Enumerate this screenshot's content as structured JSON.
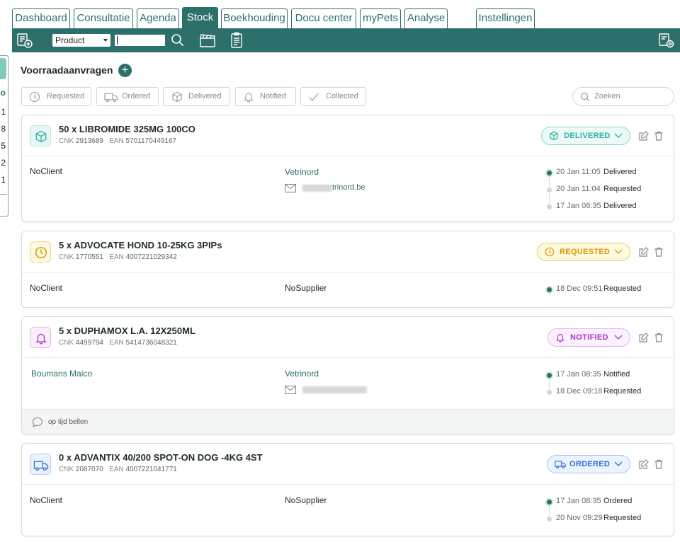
{
  "nav": {
    "tabs": [
      {
        "label": "Dashboard"
      },
      {
        "label": "Consultatie"
      },
      {
        "label": "Agenda"
      },
      {
        "label": "Stock",
        "active": true
      },
      {
        "label": "Boekhouding"
      },
      {
        "label": "Docu center"
      },
      {
        "label": "myPets"
      },
      {
        "label": "Analyse"
      },
      {
        "label": "Instellingen"
      }
    ]
  },
  "toolbar": {
    "search_type": "Product",
    "search_value": ""
  },
  "left_panel": {
    "items": [
      "o",
      "1",
      "8",
      "5",
      "2",
      "1"
    ]
  },
  "page": {
    "title": "Voorraadaanvragen"
  },
  "filters": [
    {
      "label": "Requested",
      "icon": "clock-icon"
    },
    {
      "label": "Ordered",
      "icon": "truck-icon"
    },
    {
      "label": "Delivered",
      "icon": "box-icon"
    },
    {
      "label": "Notified",
      "icon": "bell-icon"
    },
    {
      "label": "Collected",
      "icon": "check-icon"
    }
  ],
  "search": {
    "placeholder": "Zoeken"
  },
  "colors": {
    "brand": "#2d6f6b",
    "delivered": "#2bb5a0",
    "requested": "#d99a00",
    "notified": "#b035c9",
    "ordered": "#2a6fd6"
  },
  "requests": [
    {
      "product": "50 x LIBROMIDE 325MG 100CO",
      "cnk_label": "CNK",
      "cnk": "2913689",
      "ean_label": "EAN",
      "ean": "5701170449167",
      "status": "DELIVERED",
      "client": "NoClient",
      "supplier": "Vetrinord",
      "email_domain": "trinord.be",
      "timeline": [
        {
          "time": "20 Jan 11:05",
          "status": "Delivered"
        },
        {
          "time": "20 Jan 11:04",
          "status": "Requested"
        },
        {
          "time": "17 Jan 08:35",
          "status": "Delivered"
        }
      ]
    },
    {
      "product": "5 x ADVOCATE HOND 10-25KG 3PIPs",
      "cnk_label": "CNK",
      "cnk": "1770551",
      "ean_label": "EAN",
      "ean": "4007221029342",
      "status": "REQUESTED",
      "client": "NoClient",
      "supplier": "NoSupplier",
      "timeline": [
        {
          "time": "18 Dec 09:51",
          "status": "Requested"
        }
      ]
    },
    {
      "product": "5 x DUPHAMOX L.A. 12X250ML",
      "cnk_label": "CNK",
      "cnk": "4499794",
      "ean_label": "EAN",
      "ean": "5414736048321",
      "status": "NOTIFIED",
      "client": "Boumans Maico",
      "supplier": "Vetrinord",
      "timeline": [
        {
          "time": "17 Jan 08:35",
          "status": "Notified"
        },
        {
          "time": "18 Dec 09:18",
          "status": "Requested"
        }
      ],
      "note": "op tijd bellen"
    },
    {
      "product": "0 x ADVANTIX 40/200 SPOT-ON DOG -4KG 4ST",
      "cnk_label": "CNK",
      "cnk": "2087070",
      "ean_label": "EAN",
      "ean": "4007221041771",
      "status": "ORDERED",
      "client": "NoClient",
      "supplier": "NoSupplier",
      "timeline": [
        {
          "time": "17 Jan 08:35",
          "status": "Ordered"
        },
        {
          "time": "20 Nov 09:29",
          "status": "Requested"
        }
      ]
    }
  ]
}
